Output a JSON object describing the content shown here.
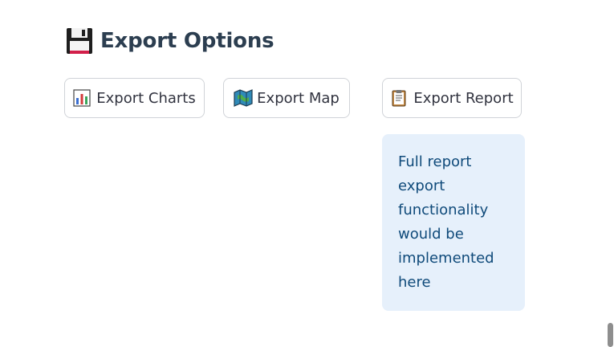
{
  "section": {
    "icon": "floppy-disk-icon",
    "title": "Export Options"
  },
  "buttons": {
    "charts": {
      "icon": "bar-chart-icon",
      "label": "Export Charts"
    },
    "map": {
      "icon": "map-icon",
      "label": "Export Map"
    },
    "report": {
      "icon": "clipboard-icon",
      "label": "Export Report"
    }
  },
  "info": {
    "text": "Full report export functionality would be implemented here"
  },
  "colors": {
    "heading": "#2c3e50",
    "info_background": "#e6f0fb",
    "info_text": "#0f4a7a",
    "button_border": "#d0d3d8"
  }
}
